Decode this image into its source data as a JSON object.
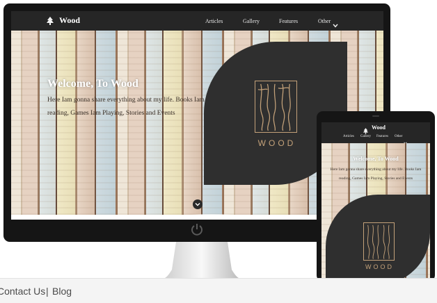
{
  "desktop": {
    "brand": "Wood",
    "nav": [
      "Articles",
      "Gallery",
      "Features",
      "Other"
    ],
    "hero_title": "Welcome, To Wood",
    "hero_text": "Here Iam gonna share everything about my life. Books Iam reading, Games Iam Playing, Stories and Events",
    "logo_text": "WOOD"
  },
  "mobile": {
    "brand": "Wood",
    "nav": [
      "Articles",
      "Gallery",
      "Features",
      "Other"
    ],
    "hero_title": "Welcome, To Wood",
    "hero_text": "Here Iam gonna share everything about my life. Books Iam reading, Games Iam Playing, Stories and Events",
    "logo_text": "WOOD"
  },
  "footer": {
    "contact": "Contact Us",
    "separator": "|",
    "blog": "Blog"
  },
  "icons": [
    "tree-icon",
    "chevron-down-icon",
    "power-icon"
  ]
}
